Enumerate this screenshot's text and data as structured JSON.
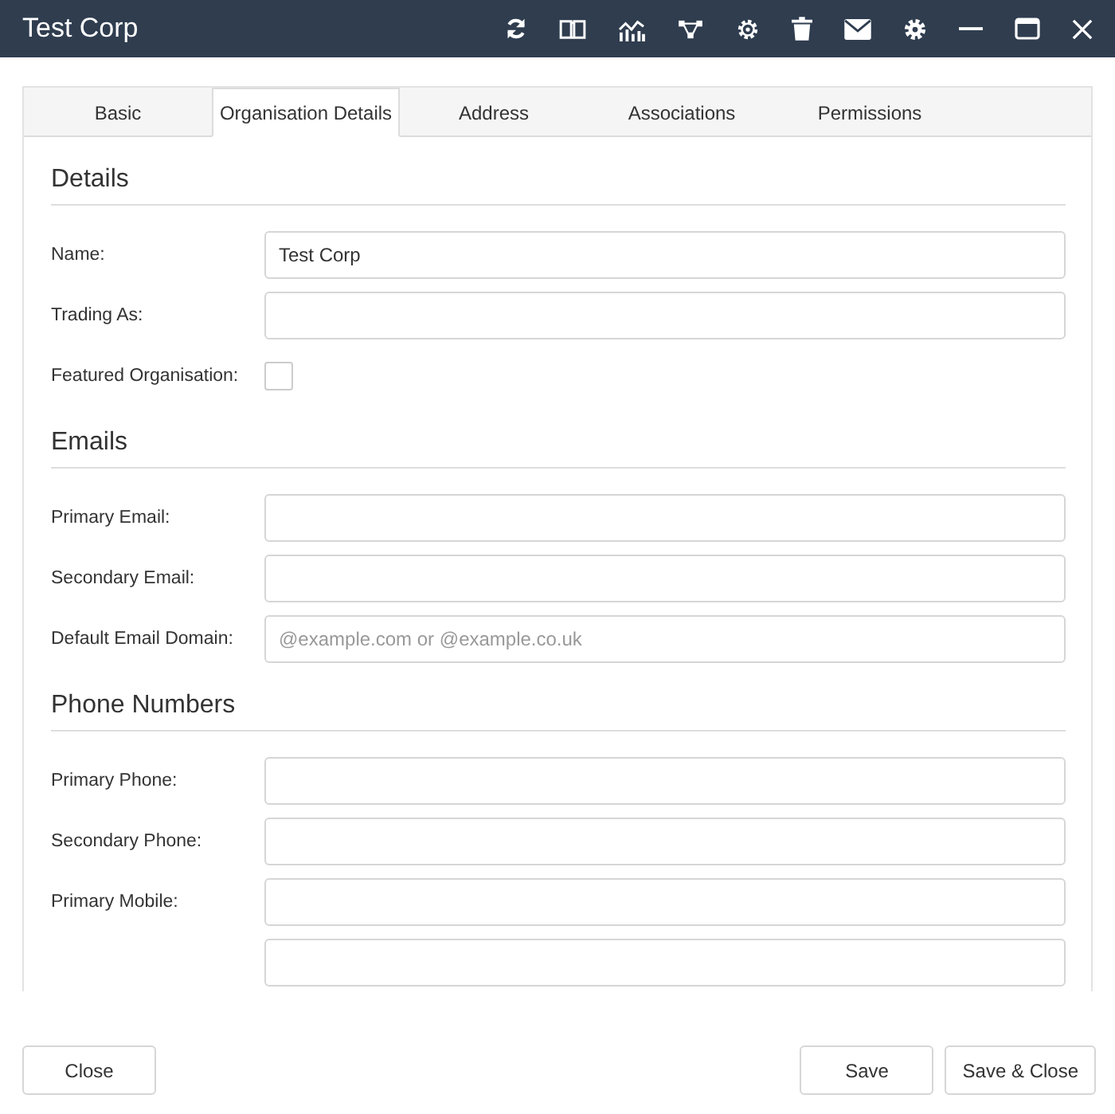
{
  "window": {
    "title": "Test Corp"
  },
  "tabs": [
    {
      "label": "Basic",
      "selected": false
    },
    {
      "label": "Organisation Details",
      "selected": true
    },
    {
      "label": "Address",
      "selected": false
    },
    {
      "label": "Associations",
      "selected": false
    },
    {
      "label": "Permissions",
      "selected": false
    }
  ],
  "sections": [
    {
      "title": "Details",
      "fields": [
        {
          "kind": "text",
          "label": "Name:",
          "value": "Test Corp"
        },
        {
          "kind": "text",
          "label": "Trading As:"
        },
        {
          "kind": "checkbox",
          "label": "Featured Organisation:",
          "checked": false
        }
      ]
    },
    {
      "title": "Emails",
      "fields": [
        {
          "kind": "text",
          "label": "Primary Email:"
        },
        {
          "kind": "text",
          "label": "Secondary Email:"
        },
        {
          "kind": "text",
          "label": "Default Email Domain:",
          "placeholder": "@example.com or @example.co.uk"
        }
      ]
    },
    {
      "title": "Phone Numbers",
      "fields": [
        {
          "kind": "text",
          "label": "Primary Phone:"
        },
        {
          "kind": "text",
          "label": "Secondary Phone:"
        },
        {
          "kind": "text",
          "label": "Primary Mobile:"
        },
        {
          "kind": "text"
        }
      ]
    }
  ],
  "footer": {
    "left_buttons": [
      "Close"
    ],
    "right_buttons": [
      "Save",
      "Save & Close"
    ]
  }
}
